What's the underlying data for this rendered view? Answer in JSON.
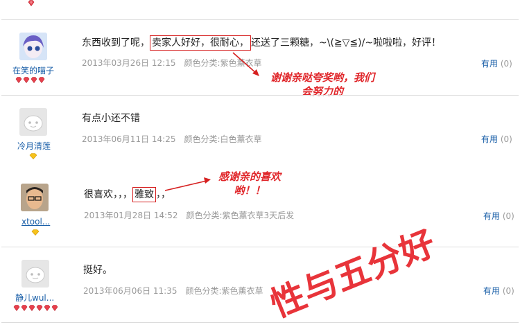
{
  "reviews": [
    {
      "user": "在笑的喵子",
      "text_before": "东西收到了呢，",
      "text_highlight": "卖家人好好，很耐心，",
      "text_after": "还送了三颗糖，~\\(≧▽≦)/~啦啦啦，好评！",
      "date": "2013年03月26日 12:15",
      "attr": "颜色分类:紫色薰衣草",
      "useful_label": "有用",
      "useful_count": "(0)",
      "reply": "谢谢亲哒夸奖哟，我们\n会努力的"
    },
    {
      "user": "冷月清莲",
      "text": "有点小还不错",
      "date": "2013年06月11日 14:25",
      "attr": "颜色分类:白色薰衣草",
      "useful_label": "有用",
      "useful_count": "(0)"
    },
    {
      "user": "xtool...",
      "text_before": "很喜欢，，，",
      "text_highlight": "雅致",
      "text_after": "，，",
      "date": "2013年01月28日 14:52",
      "attr": "颜色分类:紫色薰衣草3天后发",
      "useful_label": "有用",
      "useful_count": "(0)",
      "reply": "感谢亲的喜欢\n哟！！"
    },
    {
      "user": "静儿wul...",
      "text": "挺好。",
      "date": "2013年06月06日 11:35",
      "attr": "颜色分类:紫色薰衣草",
      "useful_label": "有用",
      "useful_count": "(0)"
    }
  ],
  "watermark": "性与五分好",
  "colors": {
    "link": "#1a5fa8",
    "accent_red": "#d62020",
    "meta_gray": "#999999"
  },
  "icons": [
    "ruby-badge-icon",
    "yellow-diamond-icon",
    "default-avatar-icon",
    "red-arrow-icon"
  ]
}
